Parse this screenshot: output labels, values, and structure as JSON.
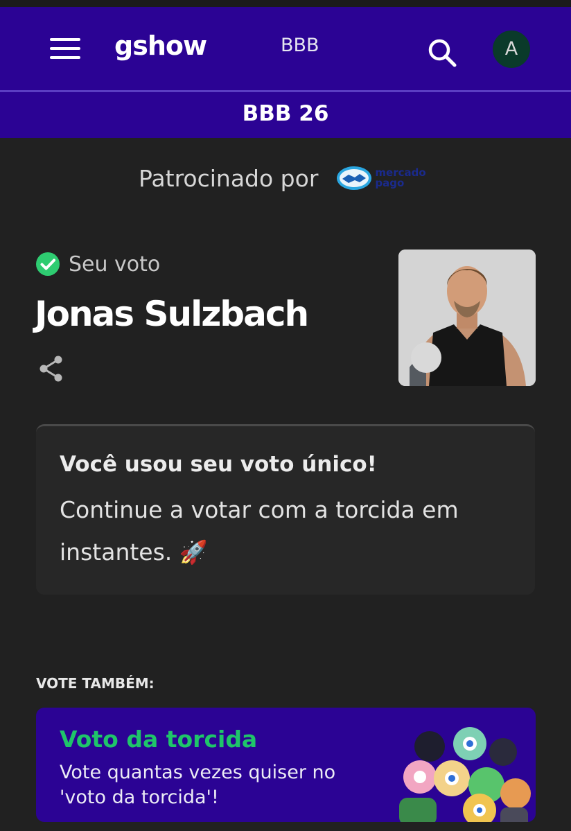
{
  "header": {
    "logo_text": "gshow",
    "nav_link": "BBB",
    "avatar_initial": "A",
    "brand_color": "#2b0394"
  },
  "subnav": {
    "title": "BBB 26"
  },
  "sponsor": {
    "label": "Patrocinado por",
    "logo_line1": "mercado",
    "logo_line2": "pago"
  },
  "vote": {
    "status_label": "Seu voto",
    "candidate_name": "Jonas Sulzbach"
  },
  "notice": {
    "title": "Você usou seu voto único!",
    "body": "Continue a votar com a torcida em instantes. 🚀"
  },
  "also_vote": {
    "label": "VOTE TAMBÉM:",
    "card_title": "Voto da torcida",
    "card_text": "Vote quantas vezes quiser no 'voto da torcida'!"
  },
  "icons": [
    "menu-icon",
    "search-icon",
    "check-circle-icon",
    "share-icon",
    "handshake-icon",
    "rocket-icon"
  ],
  "colors": {
    "accent_green": "#1fc56a",
    "check_green": "#2ecc71",
    "background": "#212121"
  }
}
